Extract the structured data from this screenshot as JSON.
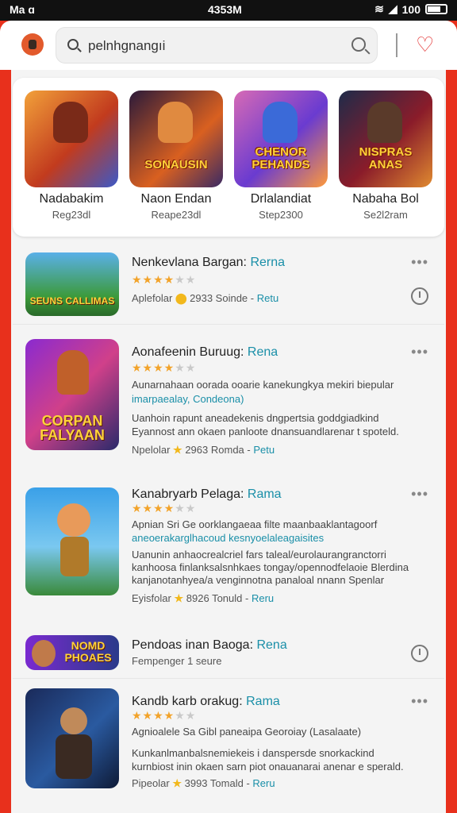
{
  "status": {
    "left": "Ma ɑ",
    "center": "4353M",
    "right": "100"
  },
  "search": {
    "query": "pelnhgnangıi"
  },
  "featured": [
    {
      "name": "Nadabakim",
      "sub": "Reg23dl",
      "logo": "",
      "colors": [
        "#f2a13a",
        "#c23b1e",
        "#3b59c8"
      ]
    },
    {
      "name": "Naon Endan",
      "sub": "Reape23dl",
      "logo": "SONAUSIN",
      "colors": [
        "#2b1a3a",
        "#d96020",
        "#3a2a64"
      ]
    },
    {
      "name": "Drlalandiat",
      "sub": "Step2300",
      "logo": "CHENOR PEHANDS",
      "colors": [
        "#d76ab5",
        "#6a3bd0",
        "#ff9a3a"
      ]
    },
    {
      "name": "Nabaha Bol",
      "sub": "Se2l2ram",
      "logo": "NISPRAS ANAS",
      "colors": [
        "#1e2b4a",
        "#8a1c2a",
        "#e08a30"
      ]
    }
  ],
  "apps": [
    {
      "title": "Nenkevlana Bargan:",
      "tag": "Rerna",
      "rating": 4,
      "meta_pre": "Aplefolar",
      "meta_num": "2933",
      "meta_mid": "Soinde -",
      "meta_link": "Retu",
      "logo": "SEUNS CALLIMAS",
      "action": "more-clock"
    },
    {
      "title": "Aonafeenin Buruug:",
      "tag": "Rena",
      "rating": 4,
      "desc1": "Aunarnahaan oorada ooarie kanekungkya mekiri biepular",
      "desc2": "imarpaealay, Condeona)",
      "desc3": "Uanhoin rapunt aneadekenis dngpertsia goddgiadkind",
      "desc4": "Eyannost ann okaen panloote dnansuandlarenar t spoteld.",
      "meta_pre": "Npelolar",
      "meta_num": "2963",
      "meta_mid": "Romda -",
      "meta_link": "Petu",
      "logo": "CORPAN FALYAAN"
    },
    {
      "title": "Kanabryarb Pelaga:",
      "tag": "Rama",
      "rating": 4,
      "desc1": "Apnian Sri Ge oorklangaeaa filte maanbaaklantagoorf",
      "desc2": "aneoerakarglhacoud kesnyoelaleagaisites",
      "desc3": "Uanunin anhaocrealcriel fars taleal/eurolaurangranctorri",
      "desc4": "kanhoosa finlanksalsnhkaes tongay/opennodfelaoie Blerdina",
      "desc5": "kanjanotanhyea/a venginnotna panaloal nnann  Spenlar",
      "meta_pre": "Eyisfolar",
      "meta_num": "8926",
      "meta_mid": "Tonuld -",
      "meta_link": "Reru",
      "logo": ""
    },
    {
      "title": "Pendoas inan Baoga:",
      "tag": "Rena",
      "sub": "Fempenger 1 seure",
      "logo": "NOMD PHOAES",
      "action": "clock"
    },
    {
      "title": "Kandb karb orakug:",
      "tag": "Rama",
      "rating": 4,
      "desc1": "Agnioalele Sa Gibl paneaipa Georoiay (Lasalaate)",
      "desc3": "Kunkanlmanbalsnemiekeis i danspersde snorkackind",
      "desc4": "kurnbiost inin okaen sarn piot onauanarai anenar e sperald.",
      "meta_pre": "Pipeolar",
      "meta_num": "3993",
      "meta_mid": "Tomald -",
      "meta_link": "Reru",
      "logo": ""
    }
  ],
  "colors": {
    "accent": "#e8301c",
    "link": "#1a8fa8",
    "star": "#f2a32a"
  }
}
